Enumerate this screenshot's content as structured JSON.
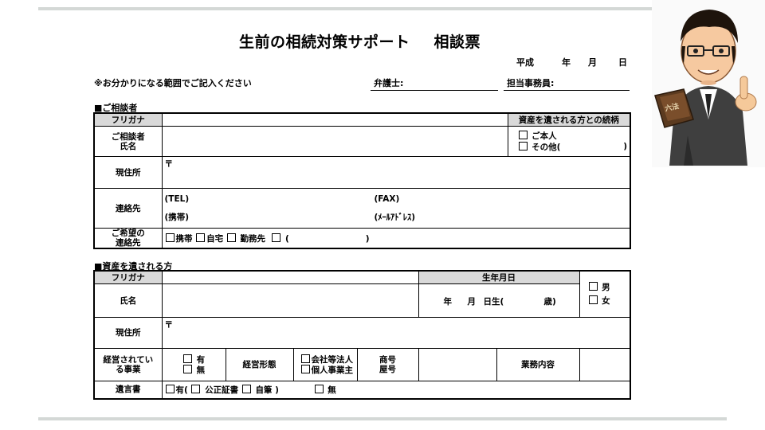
{
  "title_main": "生前の相続対策サポート",
  "title_sub": "相談票",
  "date": {
    "era": "平成",
    "year": "年",
    "month": "月",
    "day": "日"
  },
  "header": {
    "note": "※お分かりになる範囲でご記入ください",
    "lawyer": "弁護士:",
    "staff": "担当事務員:"
  },
  "section1": {
    "heading": "■ご相談者",
    "furigana": "フリガナ",
    "name_label": "ご相談者\n氏名",
    "relation_header": "資産を遺される方との続柄",
    "rel_opt1": "ご本人",
    "rel_opt2": "その他(",
    "rel_close": ")",
    "address_label": "現住所",
    "postal": "〒",
    "contact_label": "連絡先",
    "tel": "(TEL)",
    "fax": "(FAX)",
    "mobile": "(携帯)",
    "email": "(ﾒｰﾙｱﾄﾞﾚｽ)",
    "pref_label": "ご希望の\n連絡先",
    "pref_mobile": "携帯",
    "pref_home": "自宅",
    "pref_work": "勤務先",
    "pref_other": "(",
    "pref_close": ")"
  },
  "section2": {
    "heading": "■資産を遺される方",
    "furigana": "フリガナ",
    "birth_header": "生年月日",
    "name_label": "氏名",
    "year": "年",
    "month": "月",
    "day_age": "日生(",
    "age_close": "歳)",
    "male": "男",
    "female": "女",
    "address_label": "現住所",
    "postal": "〒",
    "business_label": "経営されてい\nる事業",
    "biz_yes": "有",
    "biz_no": "無",
    "form_label": "経営形態",
    "corp": "会社等法人",
    "sole": "個人事業主",
    "trade_label": "商号\n屋号",
    "content_label": "業務内容",
    "will_label": "遺言書",
    "will_yes": "有(",
    "will_notary": "公正証書",
    "will_hand": "自筆",
    "will_close": ")",
    "will_no": "無"
  },
  "avatar": {
    "book_text": "六法"
  }
}
